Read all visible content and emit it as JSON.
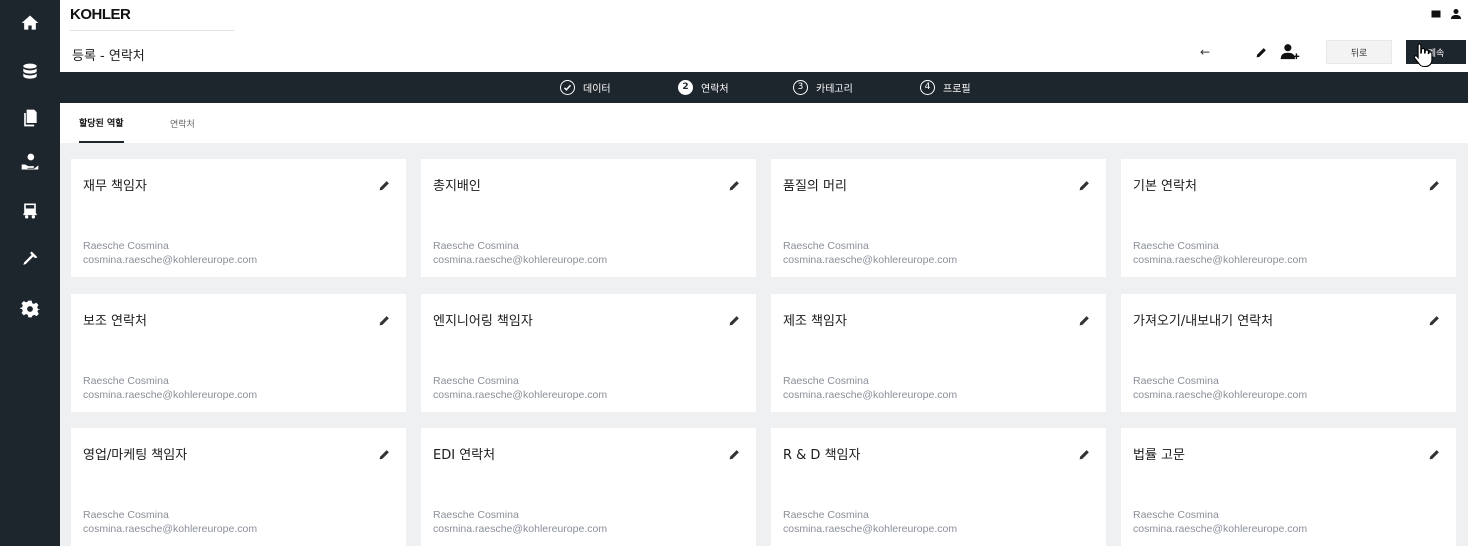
{
  "brand": {
    "logo_text": "KOHLER"
  },
  "header": {
    "page_title": "등록 - 연락처",
    "back_arrow": "←",
    "back_label": "뒤로",
    "continue_label": "계속"
  },
  "sidebar": {
    "items": [
      {
        "icon": "home-icon"
      },
      {
        "icon": "database-icon"
      },
      {
        "icon": "documents-icon"
      },
      {
        "icon": "contacts-hand-icon"
      },
      {
        "icon": "truck-icon"
      },
      {
        "icon": "tools-icon"
      },
      {
        "icon": "gear-icon"
      }
    ]
  },
  "stepper": {
    "steps": [
      {
        "num": "",
        "label": "데이터",
        "state": "done"
      },
      {
        "num": "2",
        "label": "연락처",
        "state": "active"
      },
      {
        "num": "3",
        "label": "카테고리",
        "state": "pending"
      },
      {
        "num": "4",
        "label": "프로필",
        "state": "pending"
      }
    ]
  },
  "tabs": [
    {
      "label": "할당된 역할",
      "active": true
    },
    {
      "label": "연락처",
      "active": false
    }
  ],
  "cards": [
    {
      "title": "재무 책임자",
      "name": "Raesche Cosmina",
      "email": "cosmina.raesche@kohlereurope.com"
    },
    {
      "title": "총지배인",
      "name": "Raesche Cosmina",
      "email": "cosmina.raesche@kohlereurope.com"
    },
    {
      "title": "품질의 머리",
      "name": "Raesche Cosmina",
      "email": "cosmina.raesche@kohlereurope.com"
    },
    {
      "title": "기본 연락처",
      "name": "Raesche Cosmina",
      "email": "cosmina.raesche@kohlereurope.com"
    },
    {
      "title": "보조 연락처",
      "name": "Raesche Cosmina",
      "email": "cosmina.raesche@kohlereurope.com"
    },
    {
      "title": "엔지니어링 책임자",
      "name": "Raesche Cosmina",
      "email": "cosmina.raesche@kohlereurope.com"
    },
    {
      "title": "제조 책임자",
      "name": "Raesche Cosmina",
      "email": "cosmina.raesche@kohlereurope.com"
    },
    {
      "title": "가져오기/내보내기 연락처",
      "name": "Raesche Cosmina",
      "email": "cosmina.raesche@kohlereurope.com"
    },
    {
      "title": "영업/마케팅 책임자",
      "name": "Raesche Cosmina",
      "email": "cosmina.raesche@kohlereurope.com"
    },
    {
      "title": "EDI 연락처",
      "name": "Raesche Cosmina",
      "email": "cosmina.raesche@kohlereurope.com"
    },
    {
      "title": "R & D 책임자",
      "name": "Raesche Cosmina",
      "email": "cosmina.raesche@kohlereurope.com"
    },
    {
      "title": "법률 고문",
      "name": "Raesche Cosmina",
      "email": "cosmina.raesche@kohlereurope.com"
    }
  ]
}
